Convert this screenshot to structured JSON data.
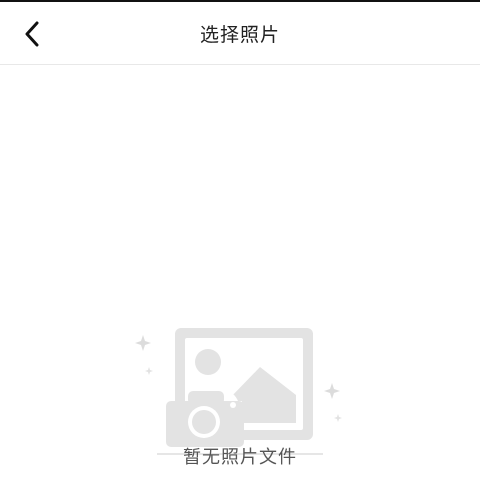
{
  "header": {
    "title": "选择照片",
    "back_icon": "chevron-left-icon"
  },
  "empty_state": {
    "icon": "no-photo-illustration-icon",
    "message": "暂无照片文件"
  },
  "colors": {
    "illustration": "#e3e3e3",
    "illustration_dark": "#d9d9d9",
    "text": "#555555",
    "title": "#222222"
  }
}
